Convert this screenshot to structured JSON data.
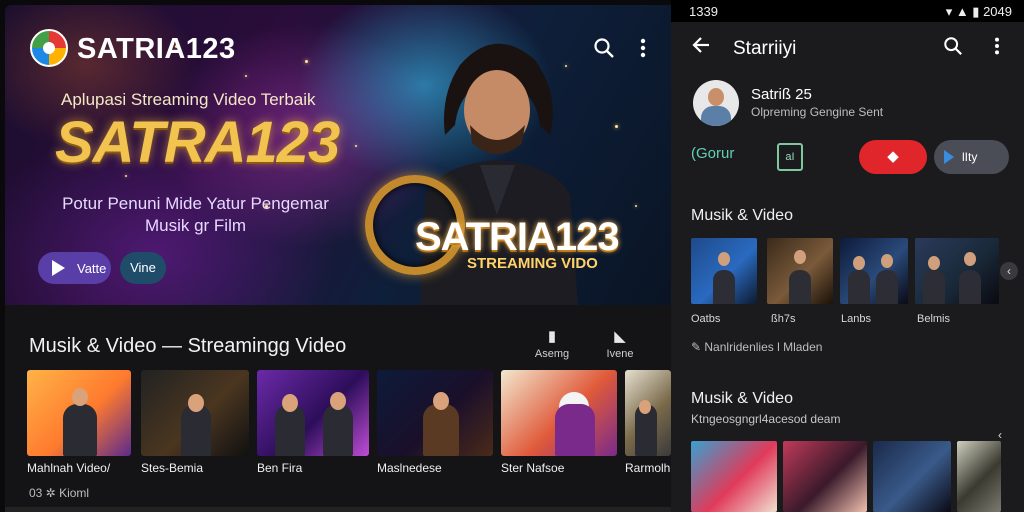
{
  "tablet": {
    "app_name": "SATRIA123",
    "hero": {
      "tagline": "Aplupasi Streaming Video Terbaik",
      "big_title": "SATRA123",
      "promo_line1": "Potur Penuni Mide Yatur Pengemar",
      "promo_line2": "Musik gr Film",
      "play_label": "Vatte",
      "view_label": "Vine",
      "brand_mark": "SATRIA123",
      "brand_sub": "STREAMING VIDO"
    },
    "section_title": "Musik & Video — Streamingg Video",
    "side_actions": [
      {
        "icon": "bookmark-icon",
        "label": "Asemg"
      },
      {
        "icon": "share-icon",
        "label": "Ivene"
      }
    ],
    "thumbnails": [
      {
        "label": "Mahlnah Video/",
        "colors": [
          "#ffb347",
          "#ff7a2e",
          "#5b2a8c"
        ]
      },
      {
        "label": "Stes-Bemia",
        "colors": [
          "#222",
          "#4a3620",
          "#111"
        ]
      },
      {
        "label": "Ben Fira",
        "colors": [
          "#6b2aa8",
          "#2d0e5a",
          "#c04dd6"
        ]
      },
      {
        "label": "Maslnedese",
        "colors": [
          "#0d1b3a",
          "#1a0f2a",
          "#4a2a1a"
        ]
      },
      {
        "label": "Ster Nafsoe",
        "colors": [
          "#f2e7cf",
          "#e05a3a",
          "#7a2a8a"
        ]
      },
      {
        "label": "Rarmolh",
        "colors": [
          "#e6e0d0",
          "#7a6a4a",
          "#3a3a3a"
        ]
      }
    ],
    "meta": "03  ✲  Kioml"
  },
  "phone": {
    "status_time": "1339",
    "status_right": "▾ ▲ ▮ 2049",
    "appbar_title": "Starriiyi",
    "channel": {
      "name": "Satriß 25",
      "subtitle": "Olpreming Gengine Sent"
    },
    "logo_a": "(Gorur",
    "logo_b": "aI",
    "red_pill_label": "◆",
    "grey_pill_label": "lIty",
    "section1_title": "Musik & Video",
    "section1_thumbs": [
      {
        "label": "Oatbs",
        "colors": [
          "#1e4a8a",
          "#2a6ac0",
          "#0e1a2e"
        ]
      },
      {
        "label": "ßh7s",
        "colors": [
          "#3a2a1a",
          "#7a5a3a",
          "#1a1208"
        ]
      },
      {
        "label": "Lanbs",
        "colors": [
          "#0e1a3a",
          "#2a4a7a",
          "#0a0a14"
        ]
      },
      {
        "label": "Belmis",
        "colors": [
          "#2a3a5a",
          "#1a2a3a",
          "#0a0a10"
        ]
      }
    ],
    "section1_meta": "Nanlridenlies l Mladen",
    "section2_title": "Musik & Video",
    "section2_sub": "Ktngeosgngrl4acesod deam",
    "section2_thumbs": [
      {
        "colors": [
          "#38a0d0",
          "#e03a5a",
          "#f0e0d0"
        ]
      },
      {
        "colors": [
          "#c03a5a",
          "#3a1a2a",
          "#f0c0b0"
        ]
      },
      {
        "colors": [
          "#1a2a4a",
          "#3a5a8a",
          "#0a0a14"
        ]
      },
      {
        "colors": [
          "#d0d0c0",
          "#3a3a30",
          "#7a7a70"
        ]
      }
    ]
  }
}
